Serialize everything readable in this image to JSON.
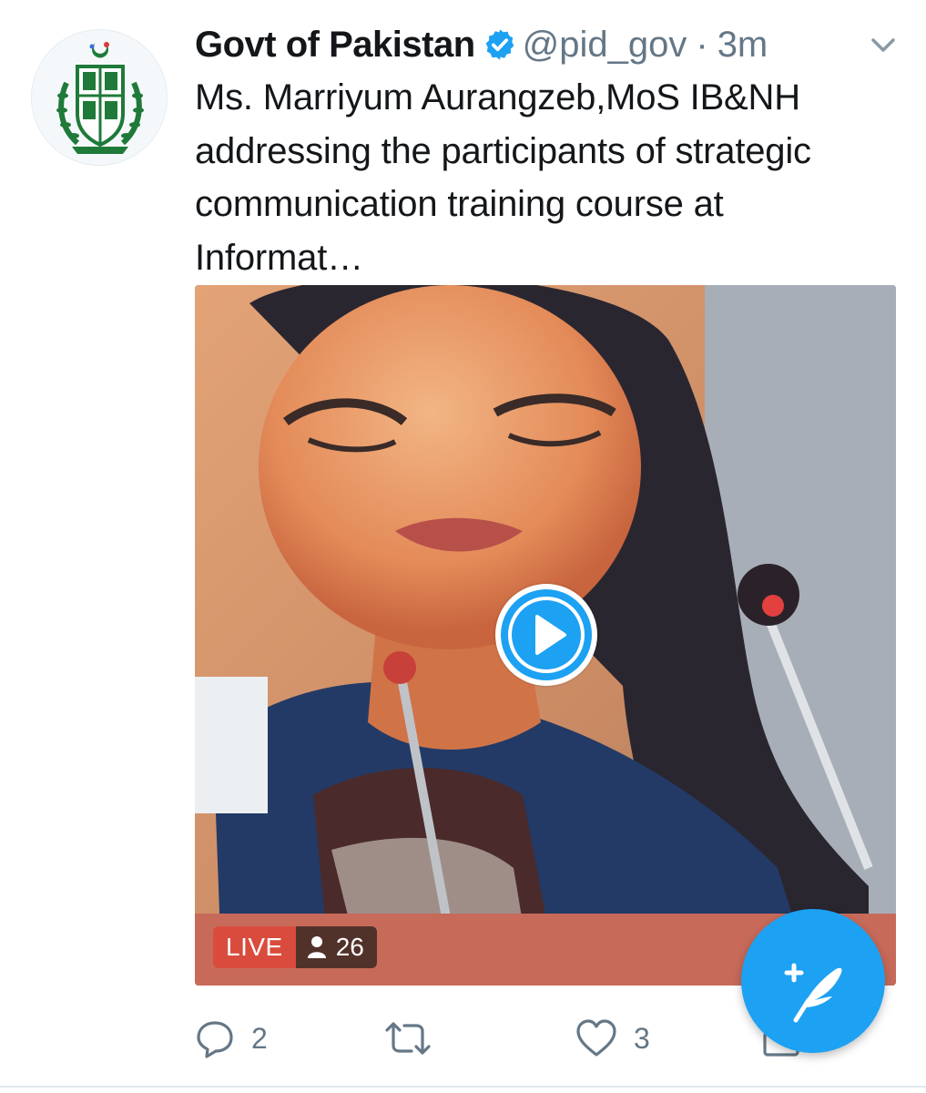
{
  "tweet": {
    "author": {
      "display_name": "Govt of Pakistan",
      "verified": true,
      "handle": "@pid_gov",
      "avatar_icon": "government-emblem-icon"
    },
    "separator": "·",
    "timestamp": "3m",
    "text": "Ms. Marriyum Aurangzeb,MoS IB&NH addressing the participants of strategic communication training course at Informat…",
    "media": {
      "type": "live-video",
      "live_label": "LIVE",
      "viewer_count": "26",
      "play_icon": "play-icon",
      "viewers_icon": "person-icon"
    },
    "actions": {
      "reply_count": "2",
      "retweet_count": "",
      "like_count": "3"
    }
  },
  "compose": {
    "icon": "compose-tweet-icon"
  },
  "colors": {
    "brand_blue": "#1da1f2",
    "text_primary": "#14171a",
    "text_secondary": "#657786",
    "live_red": "#d94c3d",
    "emblem_green": "#1f7a3a"
  }
}
